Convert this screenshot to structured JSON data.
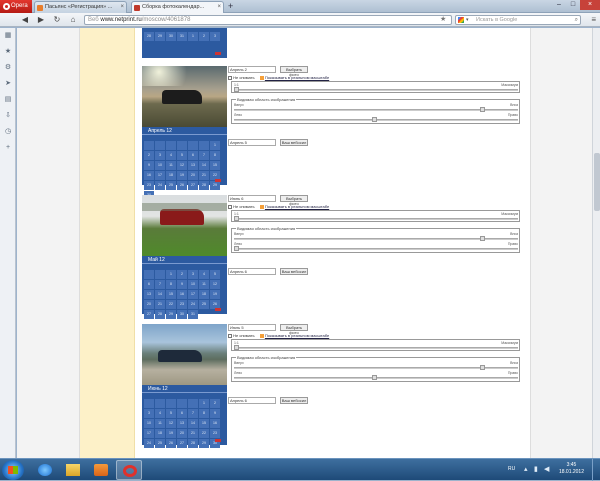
{
  "browser": {
    "opera_label": "Opera",
    "tabs": [
      {
        "title": "Пасьянс «Регистрация» ...",
        "color": "#e87d2b"
      },
      {
        "title": "Сборка фотокалендар...",
        "color": "#c0392b"
      }
    ],
    "url_prefix": "Веб",
    "url_domain": "www.netprint.ru",
    "url_path": "/moscow/4061878",
    "search_placeholder": "Искать в Google"
  },
  "sidebar_icons": [
    "star-icon",
    "gear-icon",
    "send-icon",
    "notes-icon",
    "download-icon",
    "history-icon",
    "plus-icon"
  ],
  "months": [
    {
      "photo_kind": "car-dusk",
      "cal_title": "",
      "days": [
        "28",
        "29",
        "30",
        "31",
        "1",
        "2",
        "3"
      ],
      "select_value": "",
      "select_label": "",
      "reset_label": ""
    },
    {
      "photo_kind": "car-sunset",
      "cal_title": "Апрель 12",
      "days": [
        "",
        "",
        "",
        "",
        "",
        "",
        "1",
        "2",
        "3",
        "4",
        "5",
        "6",
        "7",
        "8",
        "9",
        "10",
        "11",
        "12",
        "13",
        "14",
        "15",
        "16",
        "17",
        "18",
        "19",
        "20",
        "21",
        "22",
        "23",
        "24",
        "25",
        "26",
        "27",
        "28",
        "29",
        "30"
      ],
      "select_value": "Апрель 2",
      "select_label": "Выбрать фото",
      "checkbox_label": "Не снимать",
      "link_label": "Показывать в реальном масштабе",
      "fs_label": "",
      "scale_label": "Масштаб",
      "scale_min": "1:1",
      "scale_max": "Максимум",
      "area_label": "Видимая область изображения",
      "top_label": "Вверх",
      "bottom_label": "Вниз",
      "left_label": "Лево",
      "right_label": "Право",
      "field_value": "Апрель 5",
      "apply_label": "Ваш вебосил"
    },
    {
      "photo_kind": "car-grass",
      "cal_title": "Май 12",
      "days": [
        "",
        "",
        "1",
        "2",
        "3",
        "4",
        "5",
        "6",
        "7",
        "8",
        "9",
        "10",
        "11",
        "12",
        "13",
        "14",
        "15",
        "16",
        "17",
        "18",
        "19",
        "20",
        "21",
        "22",
        "23",
        "24",
        "25",
        "26",
        "27",
        "28",
        "29",
        "30",
        "31"
      ],
      "select_value": "Июнь 6",
      "select_label": "Выбрать фото",
      "checkbox_label": "Не снимать",
      "link_label": "Показывать в реальном масштабе",
      "scale_label": "Масштаб",
      "scale_min": "1:1",
      "scale_max": "Максимум",
      "area_label": "Видимая область изображения",
      "top_label": "Вверх",
      "bottom_label": "Вниз",
      "left_label": "Лево",
      "right_label": "Право",
      "field_value": "Апрель 6",
      "apply_label": "Ваш вебосил"
    },
    {
      "photo_kind": "car-lake",
      "cal_title": "Июнь 12",
      "days": [
        "",
        "",
        "",
        "",
        "",
        "1",
        "2",
        "3",
        "4",
        "5",
        "6",
        "7",
        "8",
        "9",
        "10",
        "11",
        "12",
        "13",
        "14",
        "15",
        "16",
        "17",
        "18",
        "19",
        "20",
        "21",
        "22",
        "23",
        "24",
        "25",
        "26",
        "27",
        "28",
        "29",
        "30"
      ],
      "select_value": "Июль 5",
      "select_label": "Выбрать фото",
      "checkbox_label": "Не снимать",
      "link_label": "Показывать в реальном масштабе",
      "scale_label": "Масштаб",
      "scale_min": "1:1",
      "scale_max": "Максимум",
      "area_label": "Видимая область изображения",
      "top_label": "Вверх",
      "bottom_label": "Вниз",
      "left_label": "Лево",
      "right_label": "Право",
      "field_value": "Апрель 6",
      "apply_label": "Ваш вебосил"
    }
  ],
  "taskbar": {
    "lang": "RU",
    "time": "3:45",
    "date": "18.01.2012"
  }
}
